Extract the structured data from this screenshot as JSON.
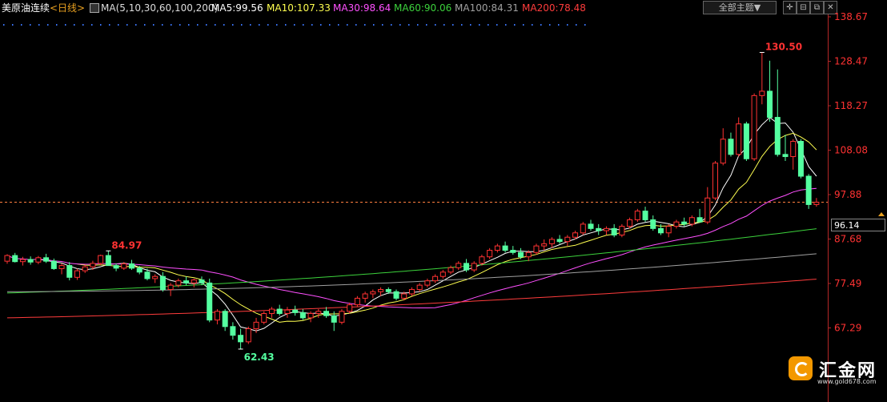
{
  "header": {
    "instrument": "美原油连续",
    "period": "<日线>",
    "ma_params": "MA(5,10,30,60,100,200)",
    "ma5": "MA5:99.56",
    "ma10": "MA10:107.33",
    "ma30": "MA30:98.64",
    "ma60": "MA60:90.06",
    "ma100": "MA100:84.31",
    "ma200": "MA200:78.48",
    "theme_select": "全部主题▼"
  },
  "colors": {
    "up": "#ff3232",
    "down": "#54ffa0",
    "ma5": "#ffffff",
    "ma10": "#ffff50",
    "ma30": "#ff50ff",
    "ma60": "#3cd23c",
    "ma100": "#a0a0a0",
    "ma200": "#ff3c3c",
    "axis_text": "#ff3232",
    "dash_line": "#ff7f3f"
  },
  "price_box": "96.14",
  "logo": {
    "name": "汇金网",
    "url": "www.gold678.com"
  },
  "chart_data": {
    "type": "candlestick",
    "ylim": [
      61.5,
      138.67
    ],
    "y_ticks": [
      "138.67",
      "128.47",
      "118.27",
      "108.08",
      "97.88",
      "87.68",
      "77.49",
      "67.29"
    ],
    "annotations": [
      {
        "label": "130.50",
        "type": "high"
      },
      {
        "label": "84.97",
        "type": "high"
      },
      {
        "label": "62.43",
        "type": "low"
      }
    ],
    "current_price": 96.14,
    "candles_ohlc": [
      [
        82.6,
        84.2,
        82.0,
        83.9
      ],
      [
        83.9,
        84.5,
        82.3,
        82.5
      ],
      [
        82.5,
        83.6,
        81.6,
        83.0
      ],
      [
        83.0,
        83.7,
        81.8,
        82.4
      ],
      [
        82.4,
        83.8,
        81.9,
        83.4
      ],
      [
        83.4,
        84.3,
        82.2,
        82.6
      ],
      [
        82.6,
        83.2,
        80.6,
        80.9
      ],
      [
        80.9,
        82.1,
        79.6,
        81.6
      ],
      [
        81.6,
        82.4,
        78.2,
        78.9
      ],
      [
        78.9,
        80.9,
        78.3,
        80.4
      ],
      [
        80.4,
        81.8,
        79.9,
        81.3
      ],
      [
        81.3,
        82.7,
        80.6,
        82.1
      ],
      [
        82.1,
        84.1,
        81.7,
        83.9
      ],
      [
        83.9,
        84.97,
        82.1,
        81.6
      ],
      [
        81.6,
        82.1,
        80.3,
        81.0
      ],
      [
        81.0,
        82.4,
        80.6,
        82.0
      ],
      [
        82.0,
        82.9,
        80.6,
        81.0
      ],
      [
        81.0,
        81.5,
        79.6,
        80.1
      ],
      [
        80.1,
        80.9,
        78.2,
        78.6
      ],
      [
        78.6,
        79.6,
        77.6,
        79.1
      ],
      [
        79.1,
        80.1,
        75.6,
        76.1
      ],
      [
        76.1,
        77.6,
        74.6,
        77.1
      ],
      [
        77.1,
        78.6,
        76.6,
        78.1
      ],
      [
        78.1,
        79.1,
        77.1,
        77.6
      ],
      [
        77.6,
        78.6,
        76.6,
        78.3
      ],
      [
        78.3,
        79.1,
        77.1,
        77.6
      ],
      [
        77.6,
        78.6,
        68.6,
        69.1
      ],
      [
        69.1,
        71.6,
        68.1,
        71.1
      ],
      [
        71.1,
        71.6,
        66.6,
        67.6
      ],
      [
        67.6,
        68.6,
        64.6,
        65.6
      ],
      [
        65.6,
        67.1,
        62.43,
        64.1
      ],
      [
        64.1,
        67.6,
        63.6,
        67.1
      ],
      [
        67.1,
        69.6,
        66.1,
        68.6
      ],
      [
        68.6,
        71.1,
        68.1,
        70.6
      ],
      [
        70.6,
        72.1,
        69.6,
        71.6
      ],
      [
        71.6,
        72.6,
        70.1,
        70.6
      ],
      [
        70.6,
        72.1,
        69.6,
        71.4
      ],
      [
        71.4,
        72.4,
        70.1,
        70.8
      ],
      [
        70.8,
        71.6,
        69.1,
        69.6
      ],
      [
        69.6,
        71.1,
        68.6,
        70.6
      ],
      [
        70.6,
        71.6,
        69.6,
        71.1
      ],
      [
        71.1,
        72.1,
        69.6,
        70.1
      ],
      [
        70.1,
        71.1,
        66.6,
        68.6
      ],
      [
        68.6,
        71.6,
        68.1,
        71.1
      ],
      [
        71.1,
        73.1,
        70.6,
        72.6
      ],
      [
        72.6,
        74.6,
        72.1,
        74.1
      ],
      [
        74.1,
        75.6,
        73.1,
        75.1
      ],
      [
        75.1,
        76.1,
        74.1,
        75.6
      ],
      [
        75.6,
        76.6,
        74.6,
        76.1
      ],
      [
        76.1,
        76.6,
        75.1,
        75.6
      ],
      [
        75.6,
        76.1,
        73.6,
        74.1
      ],
      [
        74.1,
        75.6,
        73.6,
        75.1
      ],
      [
        75.1,
        76.6,
        74.6,
        76.1
      ],
      [
        76.1,
        77.6,
        75.6,
        77.1
      ],
      [
        77.1,
        78.6,
        76.6,
        78.1
      ],
      [
        78.1,
        79.6,
        77.6,
        79.1
      ],
      [
        79.1,
        80.6,
        78.6,
        80.1
      ],
      [
        80.1,
        81.6,
        79.6,
        81.1
      ],
      [
        81.1,
        82.6,
        80.6,
        82.1
      ],
      [
        82.1,
        83.1,
        80.1,
        80.6
      ],
      [
        80.6,
        82.6,
        80.1,
        82.1
      ],
      [
        82.1,
        84.1,
        81.6,
        83.6
      ],
      [
        83.6,
        85.6,
        83.1,
        85.1
      ],
      [
        85.1,
        86.6,
        84.6,
        86.1
      ],
      [
        86.1,
        87.1,
        84.6,
        85.1
      ],
      [
        85.1,
        86.1,
        84.1,
        84.6
      ],
      [
        84.6,
        85.6,
        83.1,
        83.6
      ],
      [
        83.6,
        85.1,
        82.6,
        84.6
      ],
      [
        84.6,
        86.6,
        84.1,
        86.1
      ],
      [
        86.1,
        87.6,
        85.1,
        86.6
      ],
      [
        86.6,
        88.1,
        85.6,
        87.6
      ],
      [
        87.6,
        88.6,
        86.6,
        87.1
      ],
      [
        87.1,
        88.6,
        86.1,
        88.1
      ],
      [
        88.1,
        89.6,
        87.6,
        89.1
      ],
      [
        89.1,
        91.6,
        88.6,
        91.1
      ],
      [
        91.1,
        92.1,
        89.6,
        90.1
      ],
      [
        90.1,
        91.1,
        88.6,
        89.6
      ],
      [
        89.6,
        90.6,
        88.6,
        90.1
      ],
      [
        90.1,
        91.1,
        88.1,
        88.6
      ],
      [
        88.6,
        91.1,
        88.1,
        90.6
      ],
      [
        90.6,
        92.6,
        90.1,
        92.1
      ],
      [
        92.1,
        94.6,
        91.6,
        94.1
      ],
      [
        94.1,
        95.1,
        91.6,
        92.1
      ],
      [
        92.1,
        93.1,
        89.6,
        90.1
      ],
      [
        90.1,
        91.1,
        88.6,
        89.1
      ],
      [
        89.1,
        91.1,
        88.1,
        90.6
      ],
      [
        90.6,
        92.1,
        90.1,
        91.6
      ],
      [
        91.6,
        92.6,
        90.6,
        91.1
      ],
      [
        91.1,
        93.1,
        90.6,
        92.6
      ],
      [
        92.6,
        94.6,
        91.6,
        91.6
      ],
      [
        91.6,
        99.6,
        91.1,
        97.1
      ],
      [
        97.1,
        105.6,
        96.6,
        105.1
      ],
      [
        105.1,
        113.1,
        104.6,
        110.6
      ],
      [
        110.6,
        112.1,
        106.6,
        107.1
      ],
      [
        107.1,
        115.6,
        106.6,
        114.1
      ],
      [
        114.1,
        114.6,
        105.6,
        106.1
      ],
      [
        106.1,
        121.1,
        105.6,
        120.6
      ],
      [
        120.6,
        130.5,
        118.6,
        121.6
      ],
      [
        121.6,
        128.6,
        114.6,
        115.6
      ],
      [
        115.6,
        126.6,
        106.6,
        107.1
      ],
      [
        107.1,
        111.6,
        105.6,
        106.6
      ],
      [
        106.6,
        110.6,
        103.6,
        110.1
      ],
      [
        110.1,
        110.6,
        101.6,
        102.1
      ],
      [
        102.1,
        102.6,
        94.6,
        95.6
      ],
      [
        95.6,
        97.1,
        95.1,
        96.14
      ]
    ]
  }
}
